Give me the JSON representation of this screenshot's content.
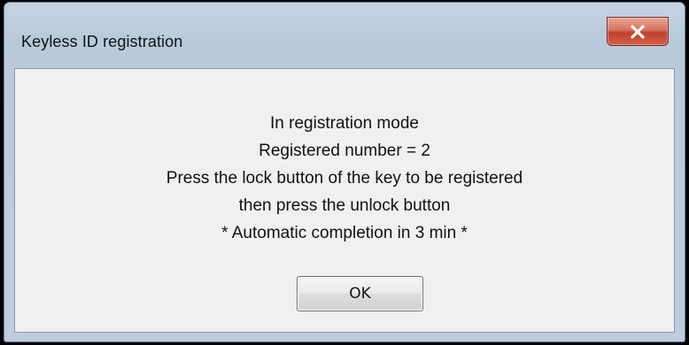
{
  "window": {
    "title": "Keyless ID registration",
    "close_icon": "close-x-icon"
  },
  "message": {
    "lines": [
      "In registration mode",
      "Registered number = 2",
      "Press the lock button of the key to be registered",
      "then press the unlock button",
      "* Automatic completion in 3 min *"
    ]
  },
  "buttons": {
    "ok_label": "OK"
  },
  "colors": {
    "title_bar": "#bfcfe0",
    "close_button": "#c94a36",
    "client_background": "#f0f0f0"
  }
}
